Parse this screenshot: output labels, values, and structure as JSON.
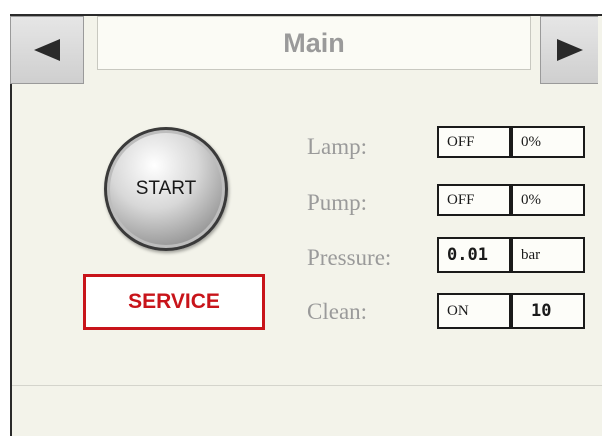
{
  "header": {
    "title": "Main"
  },
  "controls": {
    "start_label": "START",
    "service_label": "SERVICE"
  },
  "status": {
    "lamp": {
      "label": "Lamp:",
      "state": "OFF",
      "level": "0%"
    },
    "pump": {
      "label": "Pump:",
      "state": "OFF",
      "level": "0%"
    },
    "pressure": {
      "label": "Pressure:",
      "value": "0.01",
      "unit": "bar"
    },
    "clean": {
      "label": "Clean:",
      "state": "ON",
      "count": "10"
    }
  },
  "colors": {
    "panel_bg": "#f3f3ea",
    "service_red": "#c8141a",
    "label_gray": "#9a9a9a"
  },
  "icons": {
    "prev": "arrow-left-icon",
    "next": "arrow-right-icon"
  }
}
